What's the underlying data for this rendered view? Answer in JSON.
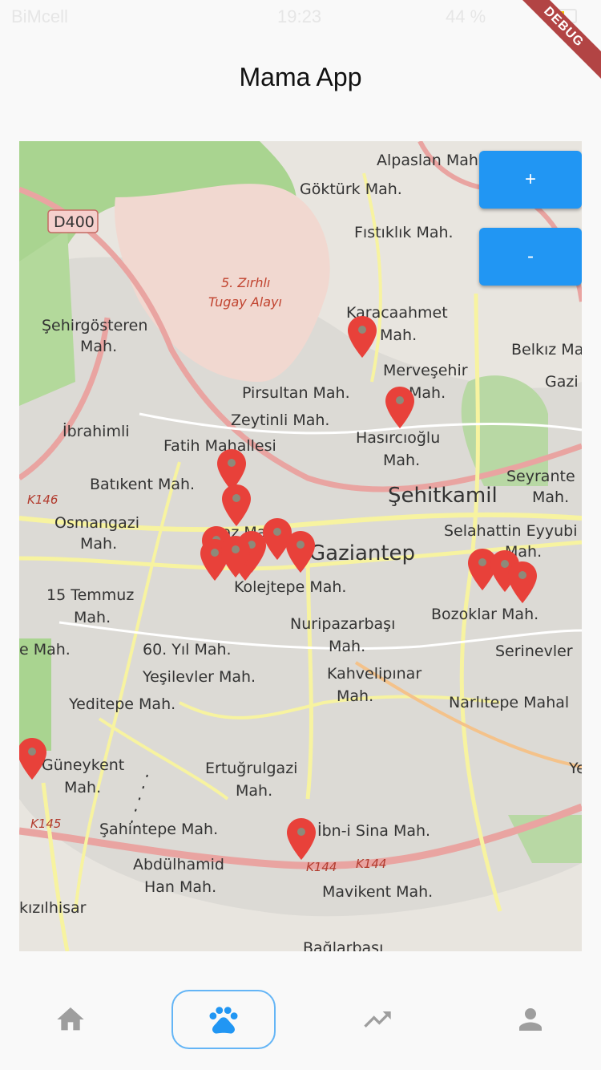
{
  "status_bar": {
    "carrier": "BiMcell",
    "time": "19:23",
    "battery": "44 %",
    "battery_level": 0.44
  },
  "debug_banner": "DEBUG",
  "app_title": "Mama App",
  "map": {
    "zoom_in_label": "+",
    "zoom_out_label": "-",
    "markers_count": 16,
    "labels": {
      "alpaslan": "Alpaslan Mah.",
      "gokturk": "Göktürk Mah.",
      "d400": "D400",
      "fistiklik": "Fıstıklık Mah.",
      "zirhli_1": "5. Zırhlı",
      "zirhli_2": "Tugay Alayı",
      "sehirgosteren_1": "Şehirgösteren",
      "sehirgosteren_2": "Mah.",
      "karacaahmet_1": "Karacaahmet",
      "karacaahmet_2": "Mah.",
      "belkiz": "Belkız Ma",
      "gazi": "Gazi",
      "mervesehir_1": "Merveşehir",
      "mervesehir_2": "Mah.",
      "pirsultan": "Pirsultan Mah.",
      "zeytinli": "Zeytinli Mah.",
      "ibrahimli": "İbrahimli",
      "fatih": "Fatih Mahallesi",
      "hasircioglu_1": "Hasırcıoğlu",
      "hasircioglu_2": "Mah.",
      "seyrantepe_1": "Seyrante",
      "seyrantepe_2": "Mah.",
      "batikent": "Batıkent Mah.",
      "k146": "K146",
      "sehitkamil": "Şehitkamil",
      "osmangazi_1": "Osmangazi",
      "osmangazi_2": "Mah.",
      "gaz_mah": "Gaz Mah.",
      "selahattin_1": "Selahattin Eyyubi",
      "selahattin_2": "Mah.",
      "gaziantep": "Gaziantep",
      "temmuz_1": "15 Temmuz",
      "temmuz_2": "Mah.",
      "kolejtepe": "Kolejtepe Mah.",
      "bozoklar": "Bozoklar Mah.",
      "nuripazarbasi_1": "Nuripazarbaşı",
      "nuripazarbasi_2": "Mah.",
      "e_mah": "e Mah.",
      "yil60": "60. Yıl Mah.",
      "serinevler": "Serinevler",
      "yesilevler": "Yeşilevler Mah.",
      "kahvelipinar_1": "Kahvelipınar",
      "kahvelipinar_2": "Mah.",
      "yeditepe": "Yeditepe Mah.",
      "narlitepe": "Narlıtepe Mahal",
      "guneykent_1": "Güneykent",
      "guneykent_2": "Mah.",
      "ertugrulgazi_1": "Ertuğrulgazi",
      "ertugrulgazi_2": "Mah.",
      "ye": "Ye",
      "k145": "K145",
      "sahintepe": "Şahintepe Mah.",
      "ibnisina": "İbn-i Sina Mah.",
      "abdulhamid_1": "Abdülhamid",
      "abdulhamid_2": "Han Mah.",
      "k144a": "K144",
      "k144b": "K144",
      "mavikent": "Mavikent Mah.",
      "kizilhisar": "kızılhisar",
      "baglarbasi": "Bağlarbaşı"
    }
  },
  "colors": {
    "accent": "#2196f3",
    "marker": "#e8413a",
    "debug": "#b24444",
    "nav_active": "#2196f3",
    "nav_inactive": "#9e9e9e"
  },
  "nav": [
    {
      "icon": "home-icon",
      "active": false
    },
    {
      "icon": "paw-icon",
      "active": true
    },
    {
      "icon": "trending-icon",
      "active": false
    },
    {
      "icon": "person-icon",
      "active": false
    }
  ]
}
